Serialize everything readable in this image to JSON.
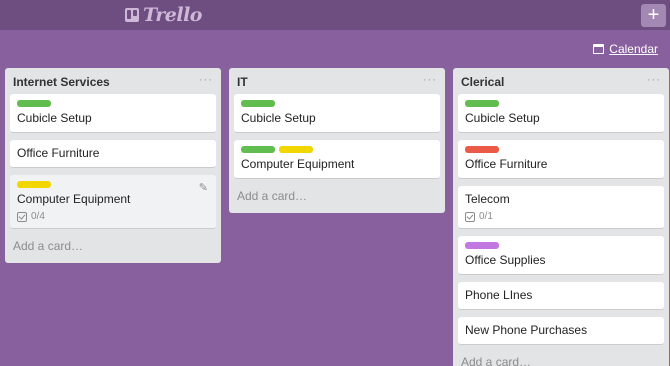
{
  "app": {
    "logo_text": "Trello",
    "add_symbol": "+",
    "calendar_label": "Calendar"
  },
  "colors": {
    "green": "#61bd4f",
    "yellow": "#f2d600",
    "red": "#eb5a46",
    "purple": "#c377e0"
  },
  "lists": [
    {
      "title": "Internet Services",
      "menu": "···",
      "cards": [
        {
          "title": "Cubicle Setup",
          "labels": [
            "#61bd4f"
          ]
        },
        {
          "title": "Office Furniture",
          "labels": []
        },
        {
          "title": "Computer Equipment",
          "labels": [
            "#f2d600"
          ],
          "checklist": "0/4",
          "hover": true
        }
      ],
      "add_card": "Add a card…"
    },
    {
      "title": "IT",
      "menu": "···",
      "cards": [
        {
          "title": "Cubicle Setup",
          "labels": [
            "#61bd4f"
          ]
        },
        {
          "title": "Computer Equipment",
          "labels": [
            "#61bd4f",
            "#f2d600"
          ]
        }
      ],
      "add_card": "Add a card…"
    },
    {
      "title": "Clerical",
      "menu": "···",
      "cards": [
        {
          "title": "Cubicle Setup",
          "labels": [
            "#61bd4f"
          ]
        },
        {
          "title": "Office Furniture",
          "labels": [
            "#eb5a46"
          ]
        },
        {
          "title": "Telecom",
          "labels": [],
          "checklist": "0/1"
        },
        {
          "title": "Office Supplies",
          "labels": [
            "#c377e0"
          ]
        },
        {
          "title": "Phone LInes",
          "labels": []
        },
        {
          "title": "New Phone Purchases",
          "labels": []
        }
      ],
      "add_card": "Add a card…"
    }
  ]
}
